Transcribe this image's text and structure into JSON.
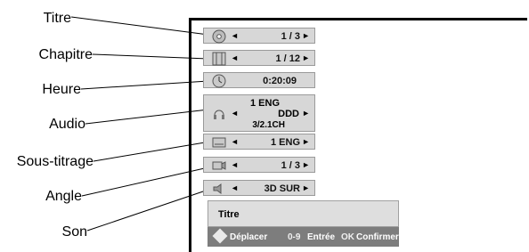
{
  "callouts": {
    "titre": "Titre",
    "chapitre": "Chapitre",
    "heure": "Heure",
    "audio": "Audio",
    "sous_titrage": "Sous-titrage",
    "angle": "Angle",
    "son": "Son"
  },
  "rows": {
    "titre": {
      "value": "1 / 3"
    },
    "chapitre": {
      "value": "1 / 12"
    },
    "heure": {
      "value": "0:20:09"
    },
    "audio": {
      "value_line1": "1 ENG",
      "value_line2": "DDD",
      "value_line3": "3/2.1CH"
    },
    "sous_titrage": {
      "value": "1 ENG"
    },
    "angle": {
      "value": "1 / 3"
    },
    "son": {
      "value": "3D SUR"
    }
  },
  "arrows": {
    "left": "◄",
    "right": "►"
  },
  "title_box": {
    "label": "Titre"
  },
  "legend": {
    "move_label": "Déplacer",
    "digits_key": "0-9",
    "enter_label": "Entrée",
    "ok_key": "OK",
    "confirm_label": "Confirmer"
  },
  "colors": {
    "row_bg": "#d7d7d7",
    "legend_bg": "#7d7d7d"
  },
  "icons": [
    "disc-icon",
    "film-icon",
    "clock-icon",
    "headphones-icon",
    "subtitle-icon",
    "camera-icon",
    "speaker-icon"
  ]
}
